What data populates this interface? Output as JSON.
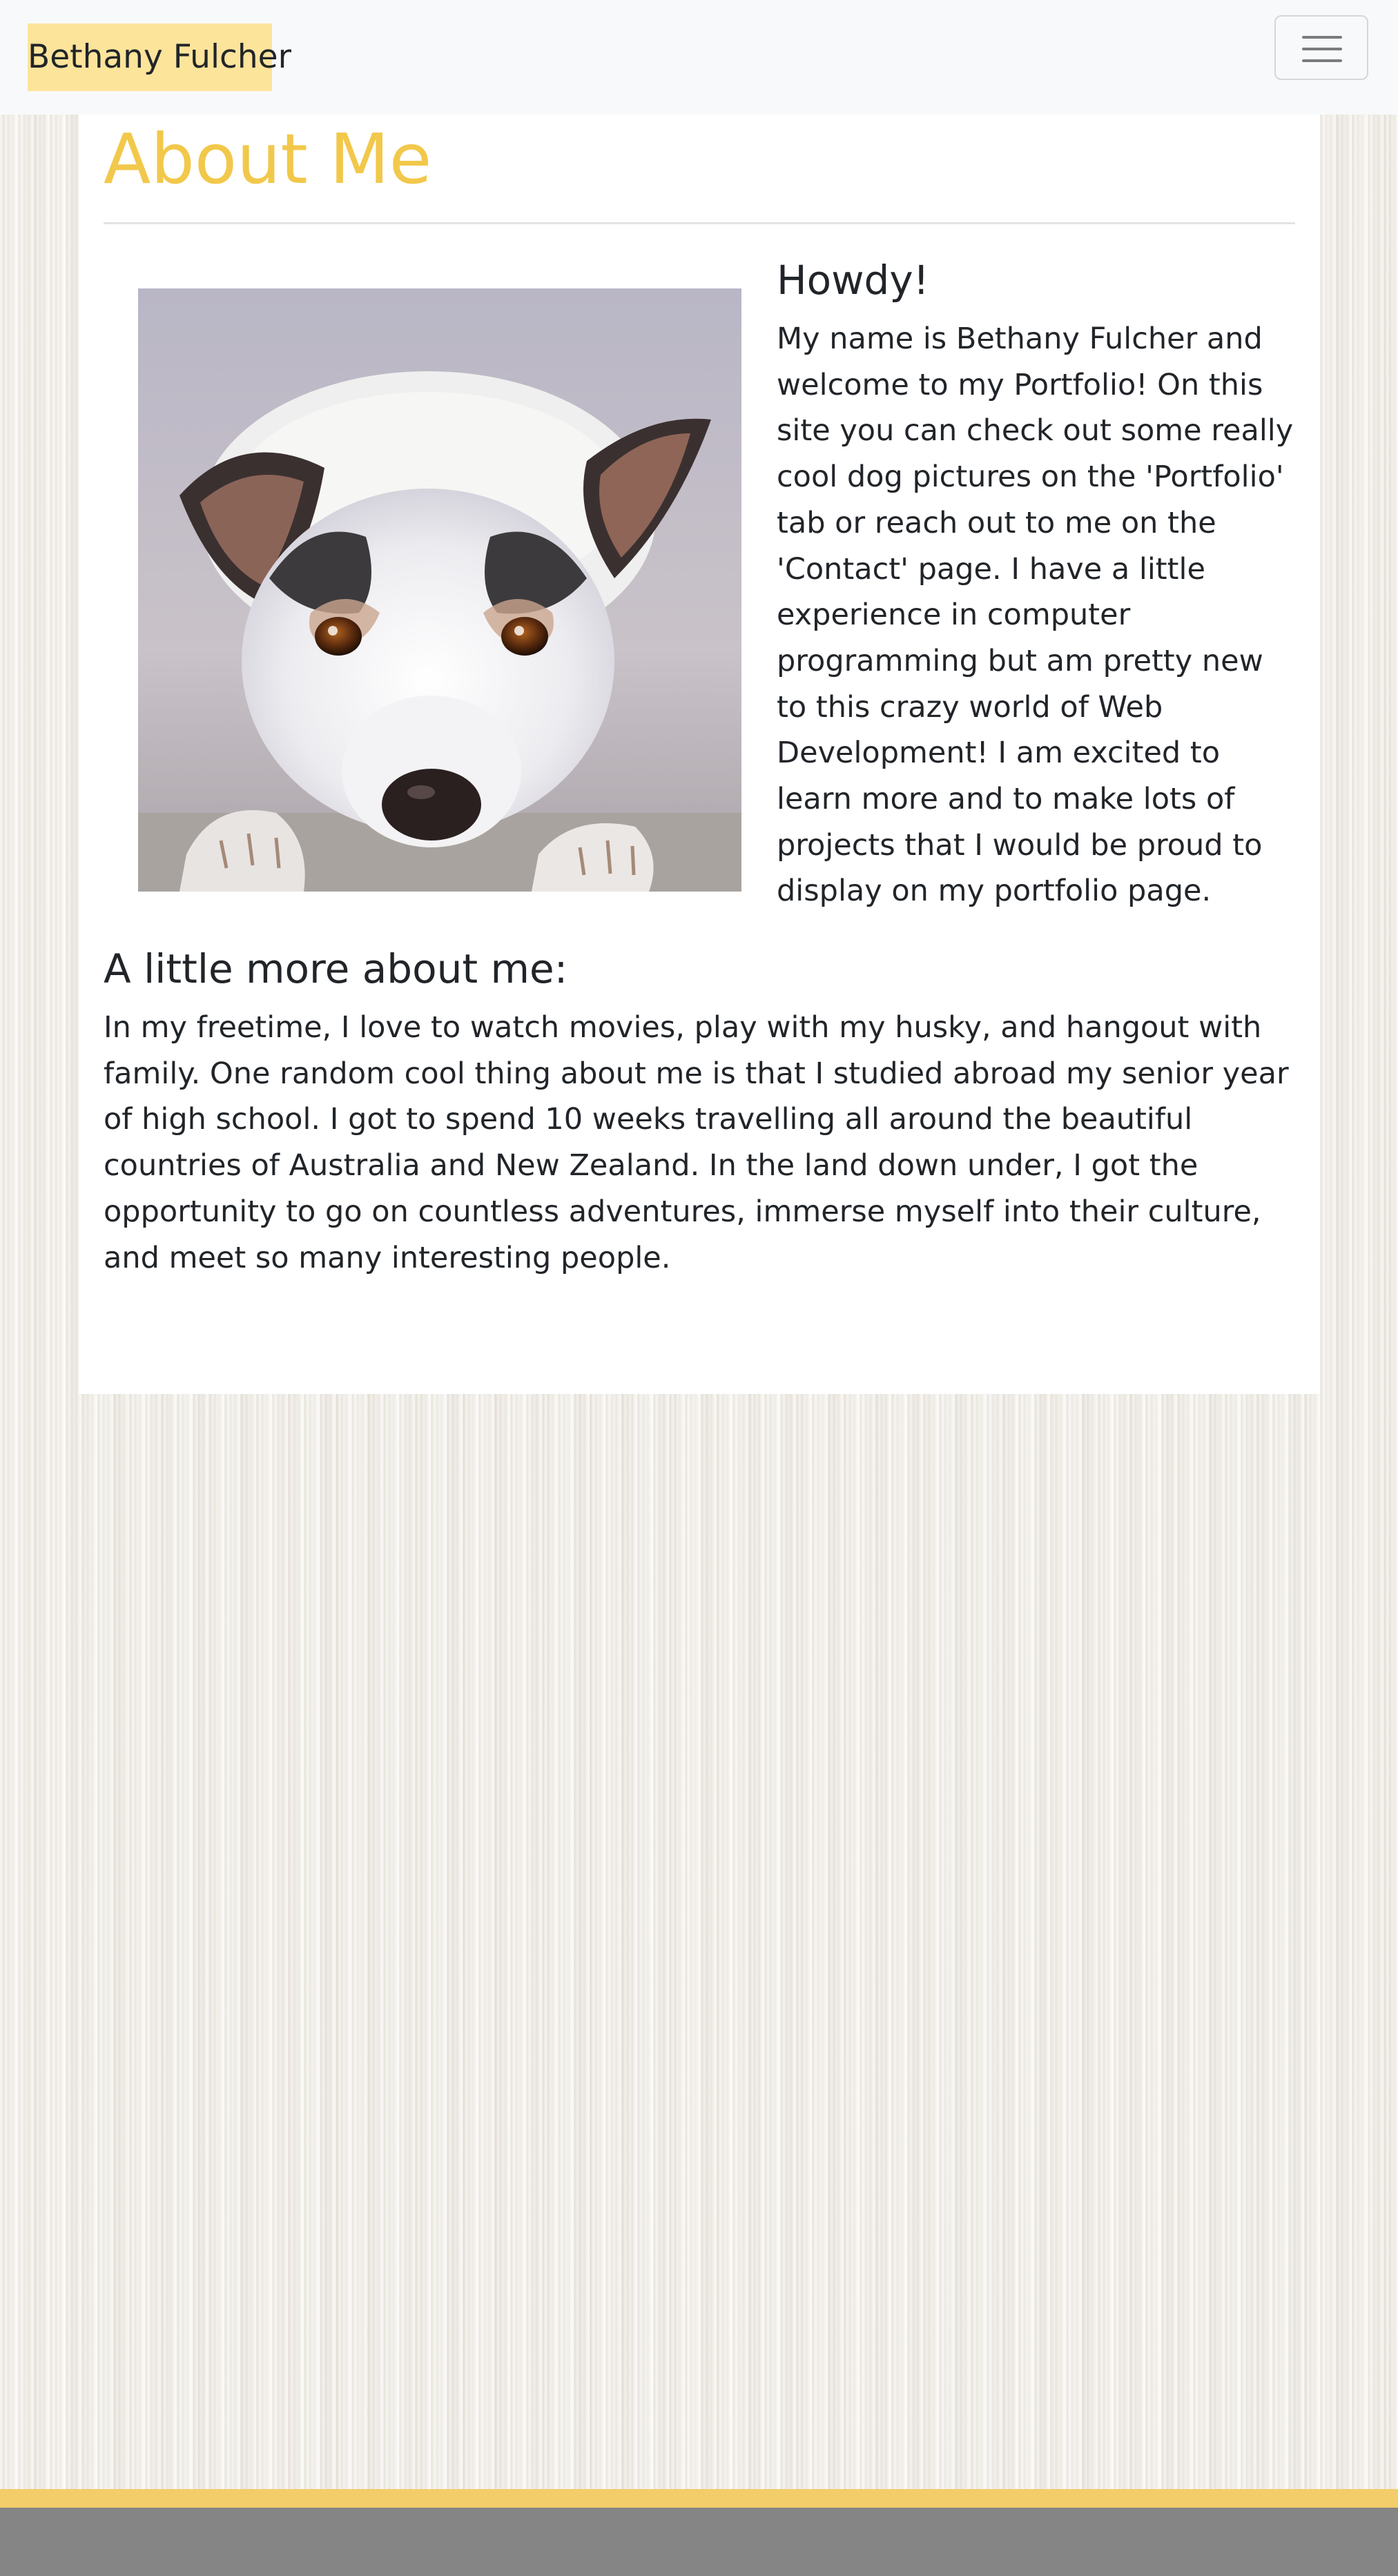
{
  "navbar": {
    "brand": "Bethany Fulcher",
    "toggler_icon": "hamburger-menu-icon"
  },
  "about": {
    "title": "About Me",
    "image_subject": "dog-photo",
    "greeting": "Howdy!",
    "intro": "My name is Bethany Fulcher and welcome to my Portfolio! On this site you can check out some really cool dog pictures on the 'Portfolio' tab or reach out to me on the 'Contact' page. I have a little experience in computer programming but am pretty new to this crazy world of Web Development! I am excited to learn more and to make lots of projects that I would be proud to display on my portfolio page.",
    "more_heading": "A little more about me:",
    "more_text": "In my freetime, I love to watch movies, play with my husky, and hangout with family. One random cool thing about me is that I studied abroad my senior year of high school. I got to spend 10 weeks travelling all around the beautiful countries of Australia and New Zealand. In the land down under, I got the opportunity to go on countless adventures, immerse myself into their culture, and meet so many interesting people."
  },
  "colors": {
    "accent": "#f2c84b",
    "brand_bg": "#fde49b",
    "footer": "#858585",
    "footer_accent": "#f2cd6a"
  }
}
